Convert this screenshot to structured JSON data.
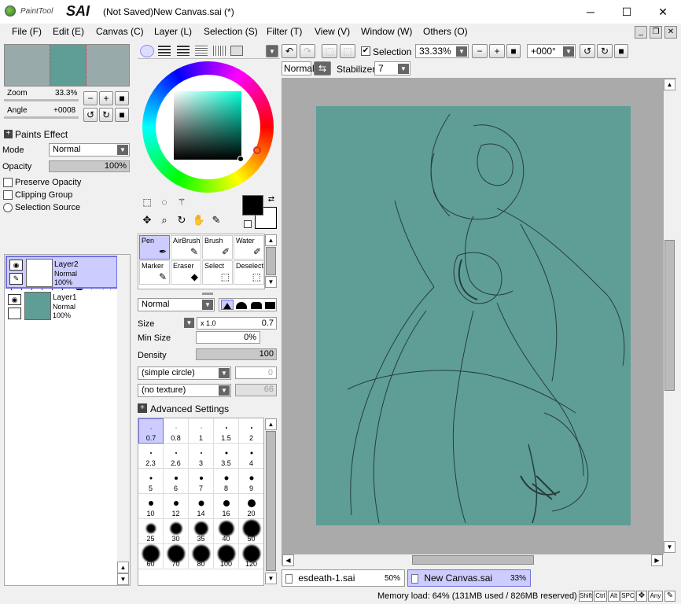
{
  "app": {
    "logo_text": "PaintTool",
    "logo_brand": "SAI",
    "title": "(Not Saved)New Canvas.sai (*)"
  },
  "window_controls": {
    "minimize": "─",
    "maximize": "☐",
    "close": "✕"
  },
  "menu": [
    "File (F)",
    "Edit (E)",
    "Canvas (C)",
    "Layer (L)",
    "Selection (S)",
    "Filter (T)",
    "View (V)",
    "Window (W)",
    "Others (O)"
  ],
  "navigator": {
    "zoom_label": "Zoom",
    "zoom_value": "33.3%",
    "angle_label": "Angle",
    "angle_value": "+0008"
  },
  "paint_effect": {
    "header": "Paints Effect",
    "mode_label": "Mode",
    "mode_value": "Normal",
    "opacity_label": "Opacity",
    "opacity_value": "100%",
    "opacity_fraction": 1.0,
    "preserve_opacity": "Preserve Opacity",
    "clipping_group": "Clipping Group",
    "selection_source": "Selection Source"
  },
  "layers": [
    {
      "name": "Layer2",
      "mode": "Normal",
      "opacity": "100%",
      "selected": true
    },
    {
      "name": "Layer1",
      "mode": "Normal",
      "opacity": "100%",
      "selected": false
    }
  ],
  "tools": [
    {
      "label": "Pen",
      "icon": "pen-icon",
      "glyph": "✒"
    },
    {
      "label": "AirBrush",
      "icon": "airbrush-icon",
      "glyph": "✎"
    },
    {
      "label": "Brush",
      "icon": "brush-icon",
      "glyph": "🖌"
    },
    {
      "label": "Water",
      "icon": "water-icon",
      "glyph": "✐"
    },
    {
      "label": "Marker",
      "icon": "marker-icon",
      "glyph": "✎"
    },
    {
      "label": "Eraser",
      "icon": "eraser-icon",
      "glyph": "◆"
    },
    {
      "label": "Select",
      "icon": "select-icon",
      "glyph": "⬚"
    },
    {
      "label": "Deselect",
      "icon": "deselect-icon",
      "glyph": "⬚"
    }
  ],
  "brush_settings": {
    "mode_value": "Normal",
    "size_label": "Size",
    "size_multiplier": "x 1.0",
    "size_value": "0.7",
    "min_size_label": "Min Size",
    "min_size_value": "0%",
    "density_label": "Density",
    "density_value": "100",
    "shape_value": "(simple circle)",
    "shape_amount": "0",
    "texture_value": "(no texture)",
    "texture_amount": "66",
    "advanced_label": "Advanced Settings"
  },
  "brush_sizes": [
    [
      "0.7",
      "0.8",
      "1",
      "1.5",
      "2"
    ],
    [
      "2.3",
      "2.6",
      "3",
      "3.5",
      "4"
    ],
    [
      "5",
      "6",
      "7",
      "8",
      "9"
    ],
    [
      "10",
      "12",
      "14",
      "16",
      "20"
    ],
    [
      "25",
      "30",
      "35",
      "40",
      "50"
    ],
    [
      "60",
      "70",
      "80",
      "100",
      "120"
    ]
  ],
  "toolbar": {
    "selection_label": "Selection",
    "selection_checked": true,
    "zoom_value": "33.33%",
    "angle_value": "+000°",
    "blend_value": "Normal",
    "stabilizer_label": "Stabilizer",
    "stabilizer_value": "7"
  },
  "file_tabs": [
    {
      "name": "esdeath-1.sai",
      "zoom": "50%",
      "active": false
    },
    {
      "name": "New Canvas.sai",
      "zoom": "33%",
      "active": true
    }
  ],
  "status": {
    "memory": "Memory load: 64% (131MB used / 826MB reserved)",
    "keys": [
      "Shift",
      "Ctrl",
      "Alt",
      "SPC",
      "Any"
    ]
  },
  "colors": {
    "canvas": "#5e9e96",
    "accent": "#ccccff",
    "primary_color": "#000000",
    "secondary_color": "#ffffff"
  }
}
